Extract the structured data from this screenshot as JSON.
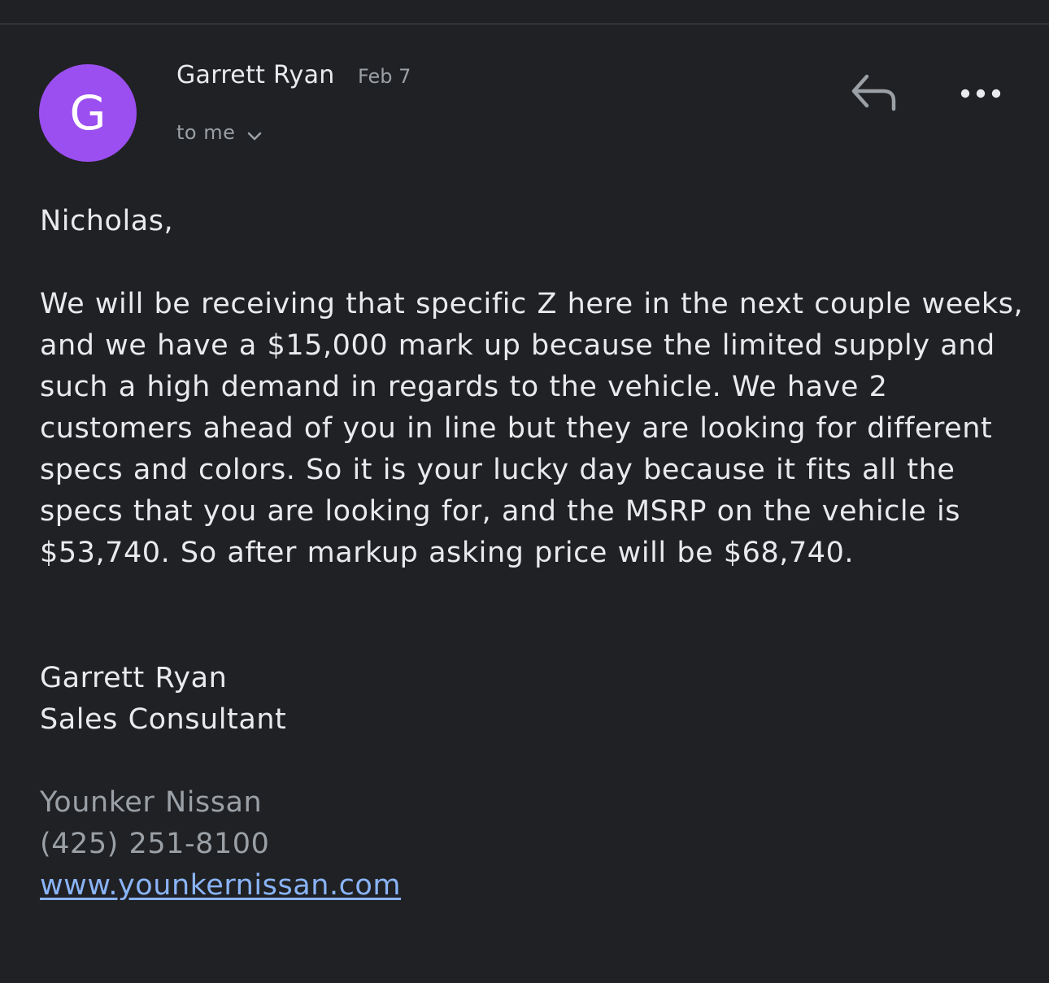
{
  "header": {
    "avatar_letter": "G",
    "avatar_color": "#9b4ff0",
    "sender_name": "Garrett Ryan",
    "date": "Feb 7",
    "recipient_label": "to me",
    "icons": {
      "expand": "chevron-down-icon",
      "reply": "reply-icon",
      "more": "more-horizontal-icon"
    }
  },
  "email": {
    "greeting": "Nicholas,",
    "body": "We will be receiving that specific Z here in the next couple weeks, and we have a $15,000 mark up because the limited supply and such a high demand in regards to the vehicle. We have 2 customers ahead of you in line but they are looking for different specs and colors. So it is your lucky day because it fits all the specs that you are looking for, and the MSRP on the vehicle is $53,740. So after markup asking price will be $68,740.",
    "signature": {
      "name": "Garrett Ryan",
      "title": "Sales Consultant",
      "company": "Younker Nissan",
      "phone": "(425) 251-8100",
      "website": "www.younkernissan.com"
    }
  },
  "colors": {
    "background": "#202124",
    "text": "#e8eaed",
    "muted_text": "#9aa0a6",
    "link": "#8ab4f8"
  }
}
